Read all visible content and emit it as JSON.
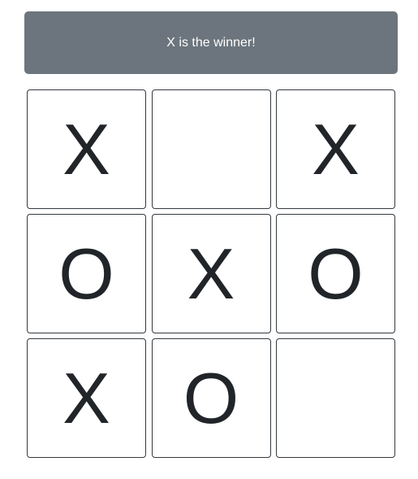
{
  "status": {
    "message": "X is the winner!"
  },
  "board": {
    "cells": [
      "X",
      "",
      "X",
      "O",
      "X",
      "O",
      "X",
      "O",
      ""
    ]
  },
  "colors": {
    "banner_bg": "#6c757d",
    "banner_text": "#ffffff",
    "mark": "#212529",
    "cell_border": "#343a40"
  }
}
